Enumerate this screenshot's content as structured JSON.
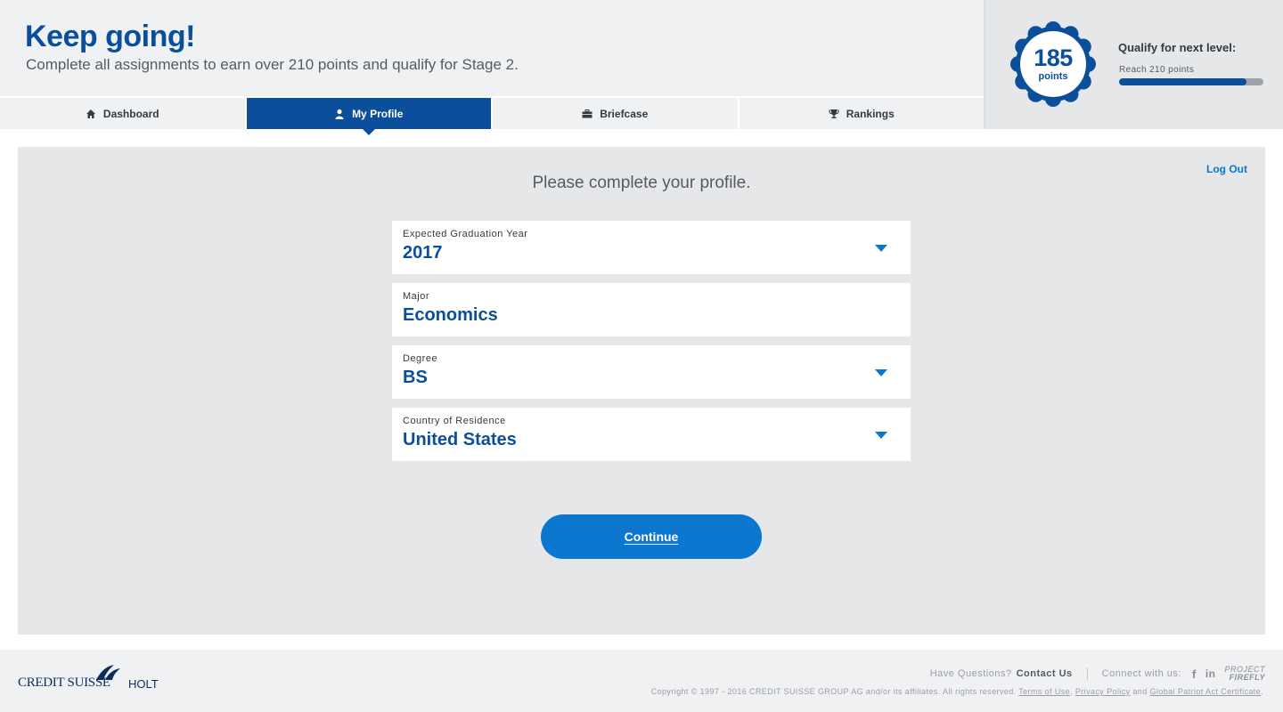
{
  "header": {
    "title": "Keep going!",
    "subtitle": "Complete all assignments to earn over 210 points and qualify for Stage 2."
  },
  "score": {
    "points": "185",
    "unit": "points",
    "next_level_title": "Qualify for next level:",
    "reach_text": "Reach 210 points",
    "progress_fraction": 0.88,
    "accent_color": "#0b4f9c"
  },
  "tabs": [
    {
      "label": "Dashboard",
      "icon": "home-icon",
      "active": false
    },
    {
      "label": "My Profile",
      "icon": "user-icon",
      "active": true
    },
    {
      "label": "Briefcase",
      "icon": "briefcase-icon",
      "active": false
    },
    {
      "label": "Rankings",
      "icon": "trophy-icon",
      "active": false
    }
  ],
  "main": {
    "logout_label": "Log Out",
    "prompt": "Please complete your profile.",
    "fields": [
      {
        "label": "Expected Graduation Year",
        "value": "2017",
        "dropdown": true
      },
      {
        "label": "Major",
        "value": "Economics",
        "dropdown": false
      },
      {
        "label": "Degree",
        "value": "BS",
        "dropdown": true
      },
      {
        "label": "Country of Residence",
        "value": "United States",
        "dropdown": true
      }
    ],
    "continue_label": "Continue"
  },
  "footer": {
    "logo_primary": "CREDIT SUISSE",
    "logo_secondary": "HOLT",
    "questions": "Have Questions?",
    "contact": "Contact Us",
    "connect": "Connect with us:",
    "social_facebook": "f",
    "social_linkedin": "in",
    "firefly_line1": "PROJECT",
    "firefly_line2": "FIREFLY",
    "copyright_text": "Copyright © 1997 - 2016 CREDIT SUISSE GROUP AG and/or its affiliates. All rights reserved.",
    "terms": "Terms of Use",
    "privacy": "Privacy Policy",
    "and": "and",
    "patriot": "Global Patriot Act Certificate"
  }
}
